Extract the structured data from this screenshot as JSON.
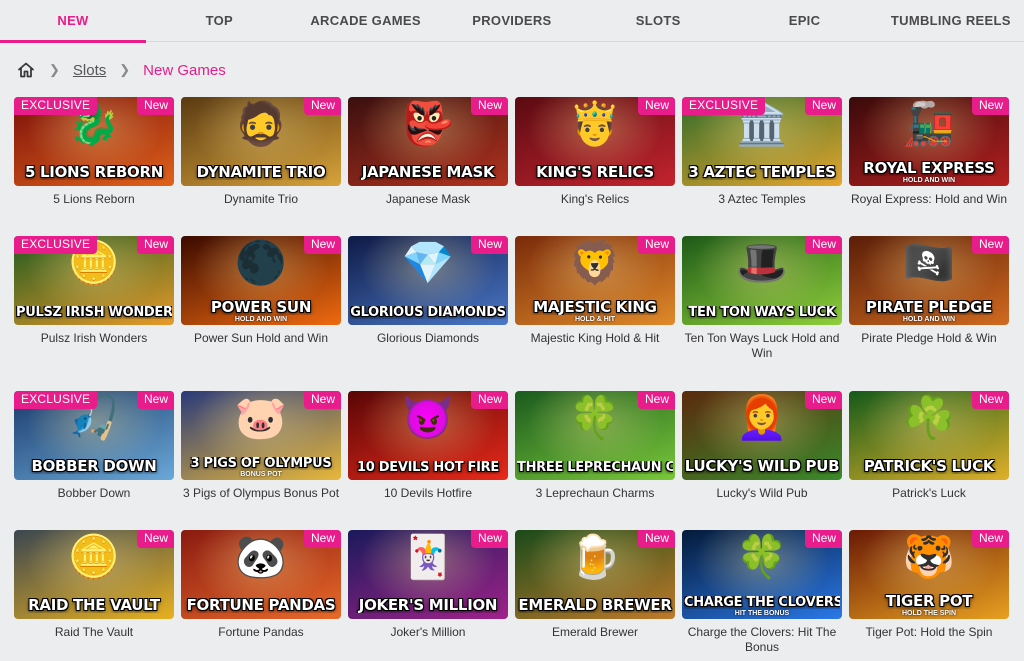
{
  "nav": {
    "tabs": [
      {
        "label": "NEW",
        "active": true
      },
      {
        "label": "TOP",
        "active": false
      },
      {
        "label": "ARCADE GAMES",
        "active": false
      },
      {
        "label": "PROVIDERS",
        "active": false
      },
      {
        "label": "SLOTS",
        "active": false
      },
      {
        "label": "EPIC",
        "active": false
      },
      {
        "label": "TUMBLING REELS",
        "active": false
      }
    ]
  },
  "breadcrumb": {
    "home_icon": "home-icon",
    "items": [
      {
        "label": "Slots",
        "link": true
      },
      {
        "label": "New Games",
        "link": false
      }
    ]
  },
  "badges": {
    "new": "New",
    "exclusive": "EXCLUSIVE"
  },
  "colors": {
    "accent": "#e81c8b",
    "background": "#ecedef"
  },
  "games": [
    {
      "title": "5 Lions Reborn",
      "logo": "5 LIONS REBORN",
      "sub": "",
      "exclusive": true,
      "art": "🐉",
      "bg": [
        "#7a0f0a",
        "#e0621b"
      ]
    },
    {
      "title": "Dynamite Trio",
      "logo": "DYNAMITE TRIO",
      "sub": "",
      "exclusive": false,
      "art": "🧔",
      "bg": [
        "#5a3a12",
        "#d7a33a"
      ]
    },
    {
      "title": "Japanese Mask",
      "logo": "JAPANESE MASK",
      "sub": "",
      "exclusive": false,
      "art": "👺",
      "bg": [
        "#3a0f0f",
        "#b3331f"
      ]
    },
    {
      "title": "King's Relics",
      "logo": "KING'S RELICS",
      "sub": "",
      "exclusive": false,
      "art": "🤴",
      "bg": [
        "#5a0a12",
        "#c4242e"
      ]
    },
    {
      "title": "3 Aztec Temples",
      "logo": "3 AZTEC TEMPLES",
      "sub": "",
      "exclusive": true,
      "art": "🏛️",
      "bg": [
        "#2f6b2a",
        "#e6a62e"
      ]
    },
    {
      "title": "Royal Express: Hold and Win",
      "logo": "ROYAL EXPRESS",
      "sub": "HOLD AND WIN",
      "exclusive": false,
      "art": "🚂",
      "bg": [
        "#3a0a0a",
        "#b52020"
      ]
    },
    {
      "title": "Pulsz Irish Wonders",
      "logo": "PULSZ IRISH WONDERS",
      "sub": "",
      "exclusive": true,
      "art": "🪙",
      "bg": [
        "#1f5a20",
        "#e89a2a"
      ]
    },
    {
      "title": "Power Sun Hold and Win",
      "logo": "POWER SUN",
      "sub": "HOLD AND WIN",
      "exclusive": false,
      "art": "🌑",
      "bg": [
        "#3a0a00",
        "#f06a10"
      ]
    },
    {
      "title": "Glorious Diamonds",
      "logo": "GLORIOUS DIAMONDS",
      "sub": "",
      "exclusive": false,
      "art": "💎",
      "bg": [
        "#0e1a46",
        "#4b78c8"
      ]
    },
    {
      "title": "Majestic King Hold & Hit",
      "logo": "MAJESTIC KING",
      "sub": "HOLD & HIT",
      "exclusive": false,
      "art": "🦁",
      "bg": [
        "#7a2a0a",
        "#e08a2a"
      ]
    },
    {
      "title": "Ten Ton Ways Luck Hold and Win",
      "logo": "TEN TON WAYS LUCK",
      "sub": "",
      "exclusive": false,
      "art": "🎩",
      "bg": [
        "#1e5a18",
        "#8fcf3a"
      ]
    },
    {
      "title": "Pirate Pledge Hold & Win",
      "logo": "PIRATE PLEDGE",
      "sub": "HOLD AND WIN",
      "exclusive": false,
      "art": "🏴‍☠️",
      "bg": [
        "#5a1e08",
        "#d06a20"
      ]
    },
    {
      "title": "Bobber Down",
      "logo": "BOBBER DOWN",
      "sub": "",
      "exclusive": true,
      "art": "🎣",
      "bg": [
        "#1a3a6a",
        "#6aa8d8"
      ]
    },
    {
      "title": "3 Pigs of Olympus Bonus Pot",
      "logo": "3 PIGS OF OLYMPUS",
      "sub": "BONUS POT",
      "exclusive": false,
      "art": "🐷",
      "bg": [
        "#2a3a7a",
        "#e8b83a"
      ]
    },
    {
      "title": "10 Devils Hotfire",
      "logo": "10 DEVILS HOT FIRE",
      "sub": "",
      "exclusive": false,
      "art": "😈",
      "bg": [
        "#5a0606",
        "#e82a1a"
      ]
    },
    {
      "title": "3 Leprechaun Charms",
      "logo": "THREE LEPRECHAUN CHARMS",
      "sub": "",
      "exclusive": false,
      "art": "🍀",
      "bg": [
        "#1a5a1e",
        "#7ac83a"
      ]
    },
    {
      "title": "Lucky's Wild Pub",
      "logo": "LUCKY'S WILD PUB",
      "sub": "",
      "exclusive": false,
      "art": "👩‍🦰",
      "bg": [
        "#5a2a0e",
        "#3a8a2a"
      ]
    },
    {
      "title": "Patrick's Luck",
      "logo": "PATRICK'S LUCK",
      "sub": "",
      "exclusive": false,
      "art": "☘️",
      "bg": [
        "#145a1a",
        "#e0b02a"
      ]
    },
    {
      "title": "Raid The Vault",
      "logo": "RAID THE VAULT",
      "sub": "",
      "exclusive": false,
      "art": "🪙",
      "bg": [
        "#3a4650",
        "#e8b020"
      ]
    },
    {
      "title": "Fortune Pandas",
      "logo": "FORTUNE PANDAS",
      "sub": "",
      "exclusive": false,
      "art": "🐼",
      "bg": [
        "#8a1a10",
        "#e86a2a"
      ]
    },
    {
      "title": "Joker's Million",
      "logo": "JOKER'S MILLION",
      "sub": "",
      "exclusive": false,
      "art": "🃏",
      "bg": [
        "#1a1a5a",
        "#a0228a"
      ]
    },
    {
      "title": "Emerald Brewer",
      "logo": "EMERALD BREWER",
      "sub": "",
      "exclusive": false,
      "art": "🍺",
      "bg": [
        "#1a4a1a",
        "#c07a2a"
      ]
    },
    {
      "title": "Charge the Clovers: Hit The Bonus",
      "logo": "CHARGE THE CLOVERS",
      "sub": "HIT THE BONUS",
      "exclusive": false,
      "art": "🍀",
      "bg": [
        "#051a3a",
        "#2a78e8"
      ]
    },
    {
      "title": "Tiger Pot: Hold the Spin",
      "logo": "TIGER POT",
      "sub": "HOLD THE SPIN",
      "exclusive": false,
      "art": "🐯",
      "bg": [
        "#6a1a06",
        "#e8a020"
      ]
    }
  ]
}
